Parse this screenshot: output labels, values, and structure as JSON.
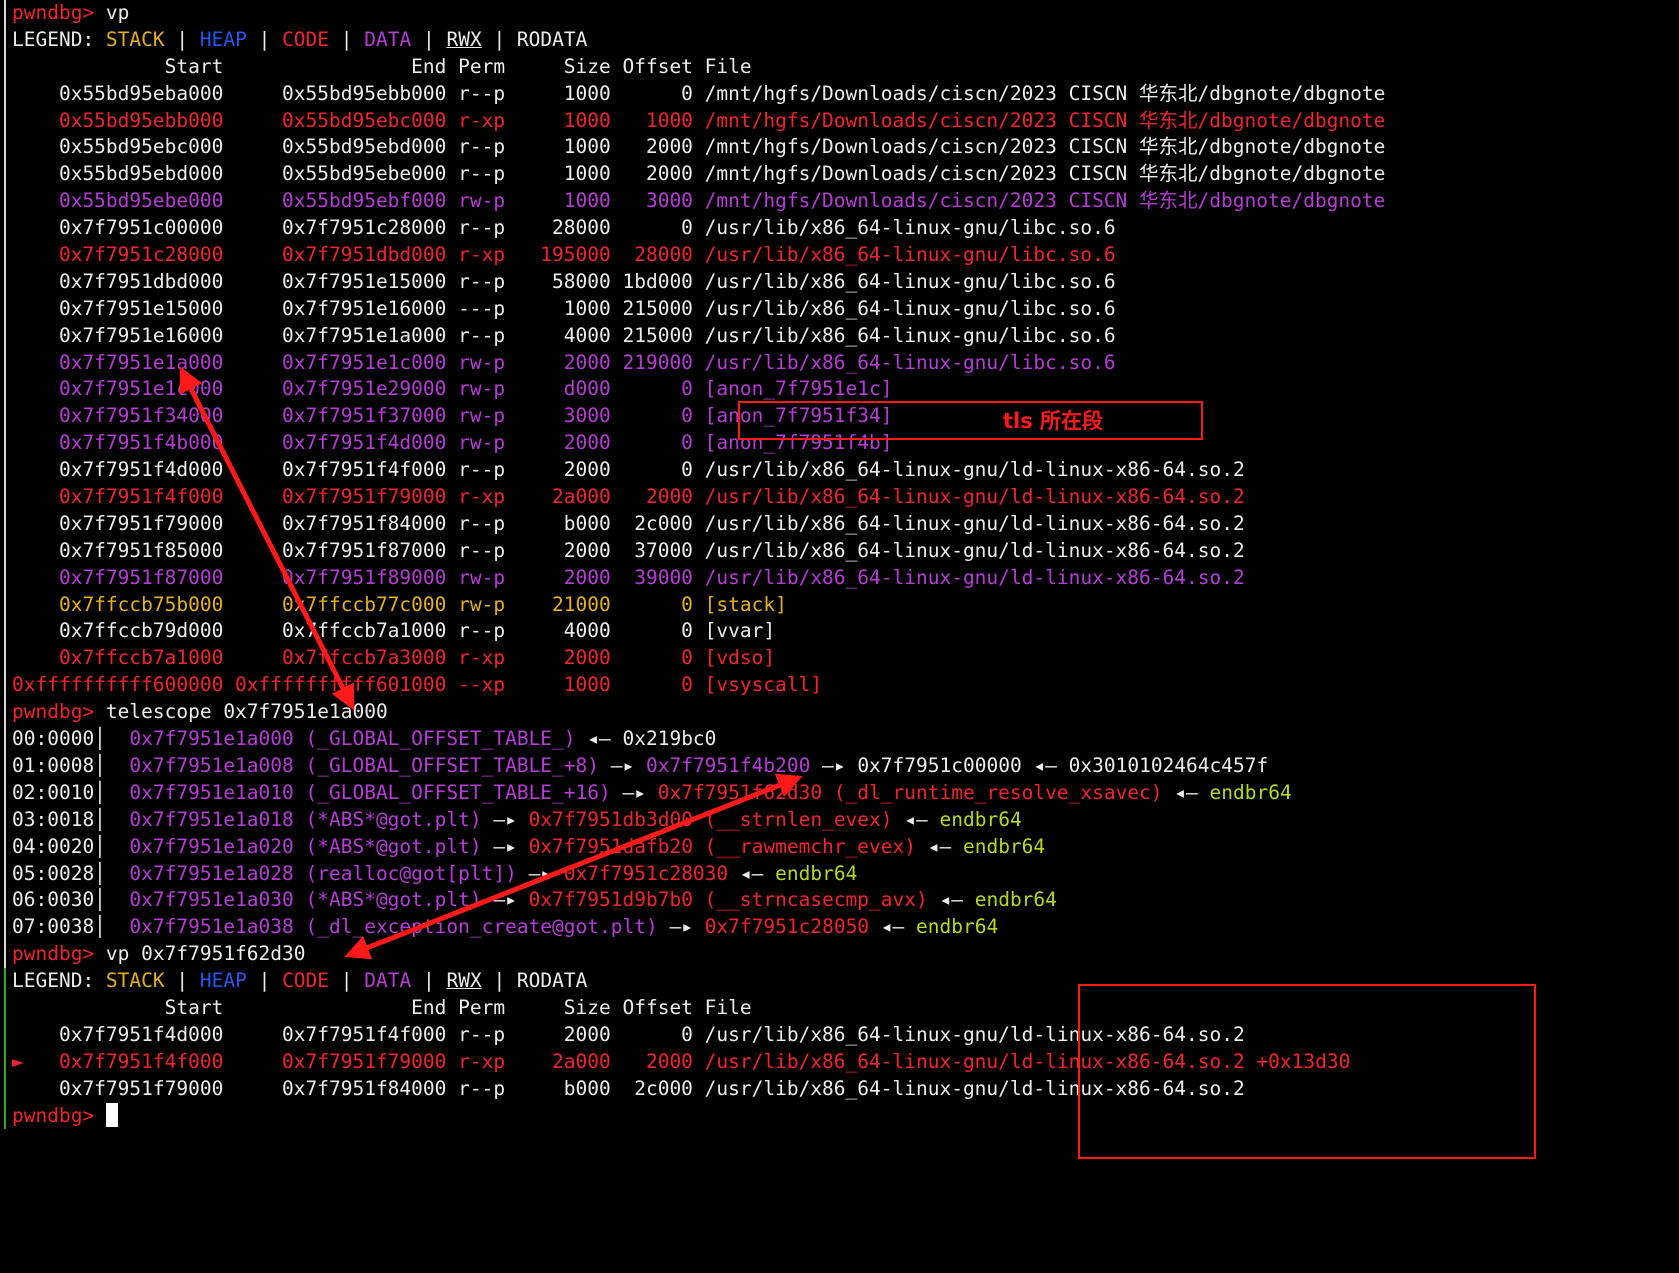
{
  "colors": {
    "text": "#ececec",
    "code_red": "#f0242e",
    "data_purple": "#b53cd4",
    "stack_yellow": "#e3b21a",
    "heap_blue": "#2656f0",
    "endbr_green": "#b5d81c",
    "annotation_red": "#ff1a1a"
  },
  "lines": [
    {
      "bar": "light",
      "segs": [
        {
          "c": "red",
          "t": "pwndbg> "
        },
        {
          "c": "w",
          "t": "vp"
        }
      ]
    },
    {
      "bar": "light",
      "segs": [
        {
          "c": "w",
          "t": "LEGEND: "
        },
        {
          "c": "yel",
          "t": "STACK"
        },
        {
          "c": "w",
          "t": " | "
        },
        {
          "c": "blu",
          "t": "HEAP"
        },
        {
          "c": "w",
          "t": " | "
        },
        {
          "c": "red",
          "t": "CODE"
        },
        {
          "c": "w",
          "t": " | "
        },
        {
          "c": "pur",
          "t": "DATA"
        },
        {
          "c": "w",
          "t": " | "
        },
        {
          "c": "w u",
          "t": "RWX"
        },
        {
          "c": "w",
          "t": " | RODATA"
        }
      ]
    },
    {
      "bar": "light",
      "segs": [
        {
          "c": "w",
          "t": "             Start                End Perm     Size Offset File"
        }
      ]
    },
    {
      "bar": "light",
      "segs": [
        {
          "c": "w",
          "t": "    0x55bd95eba000     0x55bd95ebb000 r--p     1000      0 /mnt/hgfs/Downloads/ciscn/2023 CISCN 华东北/dbgnote/dbgnote"
        }
      ]
    },
    {
      "bar": "light",
      "segs": [
        {
          "c": "red",
          "t": "    0x55bd95ebb000     0x55bd95ebc000 r-xp     1000   1000 /mnt/hgfs/Downloads/ciscn/2023 CISCN 华东北/dbgnote/dbgnote"
        }
      ]
    },
    {
      "bar": "light",
      "segs": [
        {
          "c": "w",
          "t": "    0x55bd95ebc000     0x55bd95ebd000 r--p     1000   2000 /mnt/hgfs/Downloads/ciscn/2023 CISCN 华东北/dbgnote/dbgnote"
        }
      ]
    },
    {
      "bar": "light",
      "segs": [
        {
          "c": "w",
          "t": "    0x55bd95ebd000     0x55bd95ebe000 r--p     1000   2000 /mnt/hgfs/Downloads/ciscn/2023 CISCN 华东北/dbgnote/dbgnote"
        }
      ]
    },
    {
      "bar": "light",
      "segs": [
        {
          "c": "pur",
          "t": "    0x55bd95ebe000     0x55bd95ebf000 rw-p     1000   3000 /mnt/hgfs/Downloads/ciscn/2023 CISCN 华东北/dbgnote/dbgnote"
        }
      ]
    },
    {
      "bar": "light",
      "segs": [
        {
          "c": "w",
          "t": "    0x7f7951c00000     0x7f7951c28000 r--p    28000      0 /usr/lib/x86_64-linux-gnu/libc.so.6"
        }
      ]
    },
    {
      "bar": "light",
      "segs": [
        {
          "c": "red",
          "t": "    0x7f7951c28000     0x7f7951dbd000 r-xp   195000  28000 /usr/lib/x86_64-linux-gnu/libc.so.6"
        }
      ]
    },
    {
      "bar": "light",
      "segs": [
        {
          "c": "w",
          "t": "    0x7f7951dbd000     0x7f7951e15000 r--p    58000 1bd000 /usr/lib/x86_64-linux-gnu/libc.so.6"
        }
      ]
    },
    {
      "bar": "light",
      "segs": [
        {
          "c": "w",
          "t": "    0x7f7951e15000     0x7f7951e16000 ---p     1000 215000 /usr/lib/x86_64-linux-gnu/libc.so.6"
        }
      ]
    },
    {
      "bar": "light",
      "segs": [
        {
          "c": "w",
          "t": "    0x7f7951e16000     0x7f7951e1a000 r--p     4000 215000 /usr/lib/x86_64-linux-gnu/libc.so.6"
        }
      ]
    },
    {
      "bar": "light",
      "segs": [
        {
          "c": "pur",
          "t": "    0x7f7951e1a000     0x7f7951e1c000 rw-p     2000 219000 /usr/lib/x86_64-linux-gnu/libc.so.6"
        }
      ]
    },
    {
      "bar": "light",
      "segs": [
        {
          "c": "pur",
          "t": "    0x7f7951e1c000     0x7f7951e29000 rw-p     d000      0 [anon_7f7951e1c]"
        }
      ]
    },
    {
      "bar": "light",
      "segs": [
        {
          "c": "pur",
          "t": "    0x7f7951f34000     0x7f7951f37000 rw-p     3000      0 [anon_7f7951f34]"
        }
      ]
    },
    {
      "bar": "light",
      "segs": [
        {
          "c": "pur",
          "t": "    0x7f7951f4b000     0x7f7951f4d000 rw-p     2000      0 [anon_7f7951f4b]"
        }
      ]
    },
    {
      "bar": "light",
      "segs": [
        {
          "c": "w",
          "t": "    0x7f7951f4d000     0x7f7951f4f000 r--p     2000      0 /usr/lib/x86_64-linux-gnu/ld-linux-x86-64.so.2"
        }
      ]
    },
    {
      "bar": "light",
      "segs": [
        {
          "c": "red",
          "t": "    0x7f7951f4f000     0x7f7951f79000 r-xp    2a000   2000 /usr/lib/x86_64-linux-gnu/ld-linux-x86-64.so.2"
        }
      ]
    },
    {
      "bar": "light",
      "segs": [
        {
          "c": "w",
          "t": "    0x7f7951f79000     0x7f7951f84000 r--p     b000  2c000 /usr/lib/x86_64-linux-gnu/ld-linux-x86-64.so.2"
        }
      ]
    },
    {
      "bar": "light",
      "segs": [
        {
          "c": "w",
          "t": "    0x7f7951f85000     0x7f7951f87000 r--p     2000  37000 /usr/lib/x86_64-linux-gnu/ld-linux-x86-64.so.2"
        }
      ]
    },
    {
      "bar": "light",
      "segs": [
        {
          "c": "pur",
          "t": "    0x7f7951f87000     0x7f7951f89000 rw-p     2000  39000 /usr/lib/x86_64-linux-gnu/ld-linux-x86-64.so.2"
        }
      ]
    },
    {
      "bar": "light",
      "segs": [
        {
          "c": "yel",
          "t": "    0x7ffccb75b000     0x7ffccb77c000 rw-p    21000      0 [stack]"
        }
      ]
    },
    {
      "bar": "light",
      "segs": [
        {
          "c": "w",
          "t": "    0x7ffccb79d000     0x7ffccb7a1000 r--p     4000      0 [vvar]"
        }
      ]
    },
    {
      "bar": "light",
      "segs": [
        {
          "c": "red",
          "t": "    0x7ffccb7a1000     0x7ffccb7a3000 r-xp     2000      0 [vdso]"
        }
      ]
    },
    {
      "bar": "light",
      "segs": [
        {
          "c": "red",
          "t": "0xffffffffff600000 0xffffffffff601000 --xp     1000      0 [vsyscall]"
        }
      ]
    },
    {
      "bar": "light",
      "segs": [
        {
          "c": "red",
          "t": "pwndbg> "
        },
        {
          "c": "w",
          "t": "telescope 0x7f7951e1a000"
        }
      ]
    },
    {
      "bar": "light",
      "segs": [
        {
          "c": "w",
          "t": "00:0000│  "
        },
        {
          "c": "pur",
          "t": "0x7f7951e1a000 (_GLOBAL_OFFSET_TABLE_)"
        },
        {
          "c": "w",
          "t": " ◂— 0x219bc0"
        }
      ]
    },
    {
      "bar": "light",
      "segs": [
        {
          "c": "w",
          "t": "01:0008│  "
        },
        {
          "c": "pur",
          "t": "0x7f7951e1a008 (_GLOBAL_OFFSET_TABLE_+8)"
        },
        {
          "c": "w",
          "t": " —▸ "
        },
        {
          "c": "pur",
          "t": "0x7f7951f4b200"
        },
        {
          "c": "w",
          "t": " —▸ 0x7f7951c00000 ◂— 0x3010102464c457f"
        }
      ]
    },
    {
      "bar": "light",
      "segs": [
        {
          "c": "w",
          "t": "02:0010│  "
        },
        {
          "c": "pur",
          "t": "0x7f7951e1a010 (_GLOBAL_OFFSET_TABLE_+16)"
        },
        {
          "c": "w",
          "t": " —▸ "
        },
        {
          "c": "red",
          "t": "0x7f7951f62d30 (_dl_runtime_resolve_xsavec)"
        },
        {
          "c": "w",
          "t": " ◂— "
        },
        {
          "c": "grn",
          "t": "endbr64"
        }
      ]
    },
    {
      "bar": "light",
      "segs": [
        {
          "c": "w",
          "t": "03:0018│  "
        },
        {
          "c": "pur",
          "t": "0x7f7951e1a018 (*ABS*@got.plt)"
        },
        {
          "c": "w",
          "t": " —▸ "
        },
        {
          "c": "red",
          "t": "0x7f7951db3d00 (__strnlen_evex)"
        },
        {
          "c": "w",
          "t": " ◂— "
        },
        {
          "c": "grn",
          "t": "endbr64"
        }
      ]
    },
    {
      "bar": "light",
      "segs": [
        {
          "c": "w",
          "t": "04:0020│  "
        },
        {
          "c": "pur",
          "t": "0x7f7951e1a020 (*ABS*@got.plt)"
        },
        {
          "c": "w",
          "t": " —▸ "
        },
        {
          "c": "red",
          "t": "0x7f7951dafb20 (__rawmemchr_evex)"
        },
        {
          "c": "w",
          "t": " ◂— "
        },
        {
          "c": "grn",
          "t": "endbr64"
        }
      ]
    },
    {
      "bar": "light",
      "segs": [
        {
          "c": "w",
          "t": "05:0028│  "
        },
        {
          "c": "pur",
          "t": "0x7f7951e1a028 (realloc@got[plt])"
        },
        {
          "c": "w",
          "t": " —▸ "
        },
        {
          "c": "red",
          "t": "0x7f7951c28030"
        },
        {
          "c": "w",
          "t": " ◂— "
        },
        {
          "c": "grn",
          "t": "endbr64"
        }
      ]
    },
    {
      "bar": "light",
      "segs": [
        {
          "c": "w",
          "t": "06:0030│  "
        },
        {
          "c": "pur",
          "t": "0x7f7951e1a030 (*ABS*@got.plt)"
        },
        {
          "c": "w",
          "t": " —▸ "
        },
        {
          "c": "red",
          "t": "0x7f7951d9b7b0 (__strncasecmp_avx)"
        },
        {
          "c": "w",
          "t": " ◂— "
        },
        {
          "c": "grn",
          "t": "endbr64"
        }
      ]
    },
    {
      "bar": "light",
      "segs": [
        {
          "c": "w",
          "t": "07:0038│  "
        },
        {
          "c": "pur",
          "t": "0x7f7951e1a038 (_dl_exception_create@got.plt)"
        },
        {
          "c": "w",
          "t": " —▸ "
        },
        {
          "c": "red",
          "t": "0x7f7951c28050"
        },
        {
          "c": "w",
          "t": " ◂— "
        },
        {
          "c": "grn",
          "t": "endbr64"
        }
      ]
    },
    {
      "bar": "light",
      "segs": [
        {
          "c": "red",
          "t": "pwndbg> "
        },
        {
          "c": "w",
          "t": "vp 0x7f7951f62d30"
        }
      ]
    },
    {
      "bar": "green",
      "segs": [
        {
          "c": "w",
          "t": "LEGEND: "
        },
        {
          "c": "yel",
          "t": "STACK"
        },
        {
          "c": "w",
          "t": " | "
        },
        {
          "c": "blu",
          "t": "HEAP"
        },
        {
          "c": "w",
          "t": " | "
        },
        {
          "c": "red",
          "t": "CODE"
        },
        {
          "c": "w",
          "t": " | "
        },
        {
          "c": "pur",
          "t": "DATA"
        },
        {
          "c": "w",
          "t": " | "
        },
        {
          "c": "w u",
          "t": "RWX"
        },
        {
          "c": "w",
          "t": " | RODATA"
        }
      ]
    },
    {
      "bar": "green",
      "segs": [
        {
          "c": "w",
          "t": "             Start                End Perm     Size Offset File"
        }
      ]
    },
    {
      "bar": "green",
      "segs": [
        {
          "c": "w",
          "t": "    0x7f7951f4d000     0x7f7951f4f000 r--p     2000      0 /usr/lib/x86_64-linux-gnu/ld-linux-x86-64.so.2"
        }
      ]
    },
    {
      "bar": "green",
      "segs": [
        {
          "c": "red",
          "t": "►   0x7f7951f4f000     0x7f7951f79000 r-xp    2a000   2000 /usr/lib/x86_64-linux-gnu/ld-linux-x86-64.so.2 +0x13d30"
        }
      ]
    },
    {
      "bar": "green",
      "segs": [
        {
          "c": "w",
          "t": "    0x7f7951f79000     0x7f7951f84000 r--p     b000  2c000 /usr/lib/x86_64-linux-gnu/ld-linux-x86-64.so.2"
        }
      ]
    },
    {
      "bar": "green",
      "segs": [
        {
          "c": "red",
          "t": "pwndbg> "
        }
      ],
      "cursor": true
    }
  ],
  "annotation": {
    "label": "tls 所在段"
  }
}
